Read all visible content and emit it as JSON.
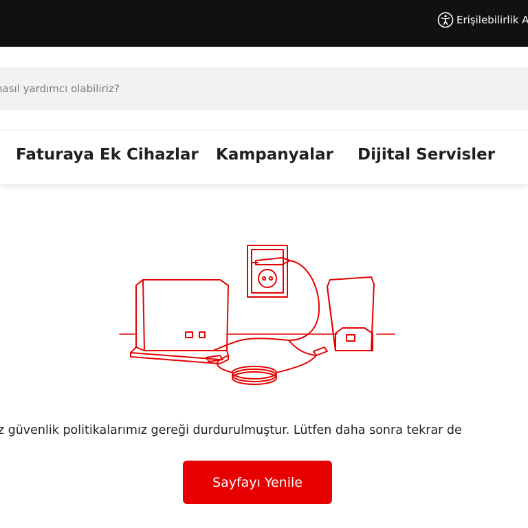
{
  "header": {
    "accessibility_label": "Erişilebilirlik A"
  },
  "search": {
    "placeholder": "nasıl yardımcı olabiliriz?"
  },
  "nav": {
    "items": [
      {
        "label": "Faturaya Ek Cihazlar"
      },
      {
        "label": "Kampanyalar"
      },
      {
        "label": "Dijital Servisler"
      }
    ]
  },
  "main": {
    "message": "iz güvenlik politikalarımız gereği durdurulmuştur. Lütfen daha sonra tekrar de",
    "refresh_label": "Sayfayı Yenile"
  },
  "colors": {
    "brand_red": "#e60000",
    "topbar": "#111111"
  }
}
